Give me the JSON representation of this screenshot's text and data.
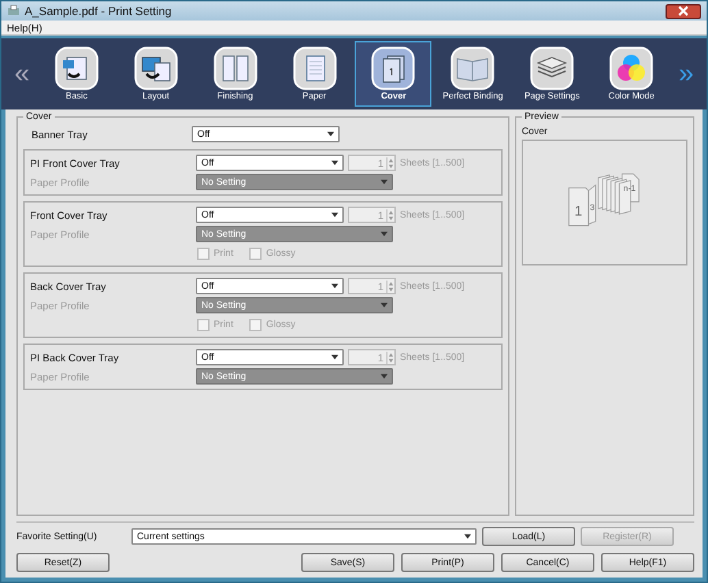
{
  "window": {
    "title": "A_Sample.pdf - Print Setting"
  },
  "menu": [
    {
      "label": "Help(H)"
    }
  ],
  "nav": {
    "prev": "«",
    "next": "»",
    "tabs": [
      {
        "label": "Basic",
        "kind": "basic",
        "selected": false
      },
      {
        "label": "Layout",
        "kind": "layout",
        "selected": false
      },
      {
        "label": "Finishing",
        "kind": "finishing",
        "selected": false
      },
      {
        "label": "Paper",
        "kind": "paper",
        "selected": false
      },
      {
        "label": "Cover",
        "kind": "cover",
        "selected": true
      },
      {
        "label": "Perfect Binding",
        "kind": "binding",
        "selected": false
      },
      {
        "label": "Page Settings",
        "kind": "pages",
        "selected": false
      },
      {
        "label": "Color Mode",
        "kind": "color",
        "selected": false
      }
    ]
  },
  "cover": {
    "title": "Cover",
    "banner": {
      "label": "Banner Tray",
      "value": "Off"
    },
    "groups": [
      {
        "label": "PI Front Cover Tray",
        "value": "Off",
        "sheets": "1",
        "range": "Sheets [1..500]",
        "profile_label": "Paper Profile",
        "profile_value": "No Setting"
      },
      {
        "label": "Front Cover Tray",
        "value": "Off",
        "sheets": "1",
        "range": "Sheets [1..500]",
        "profile_label": "Paper Profile",
        "profile_value": "No Setting",
        "options": [
          {
            "label": "Print",
            "checked": false
          },
          {
            "label": "Glossy",
            "checked": false
          }
        ]
      },
      {
        "label": "Back Cover Tray",
        "value": "Off",
        "sheets": "1",
        "range": "Sheets [1..500]",
        "profile_label": "Paper Profile",
        "profile_value": "No Setting",
        "options": [
          {
            "label": "Print",
            "checked": false
          },
          {
            "label": "Glossy",
            "checked": false
          }
        ]
      },
      {
        "label": "PI Back Cover Tray",
        "value": "Off",
        "sheets": "1",
        "range": "Sheets [1..500]",
        "profile_label": "Paper Profile",
        "profile_value": "No Setting"
      }
    ]
  },
  "preview": {
    "title": "Preview",
    "caption": "Cover",
    "pages": [
      "1",
      "3",
      "n-1"
    ]
  },
  "favorite": {
    "label": "Favorite Setting(U)",
    "value": "Current settings",
    "buttons": [
      {
        "label": "Load(L)",
        "disabled": false
      },
      {
        "label": "Register(R)",
        "disabled": true
      }
    ]
  },
  "footer": {
    "reset": "Reset(Z)",
    "buttons": [
      "Save(S)",
      "Print(P)",
      "Cancel(C)",
      "Help(F1)"
    ]
  }
}
